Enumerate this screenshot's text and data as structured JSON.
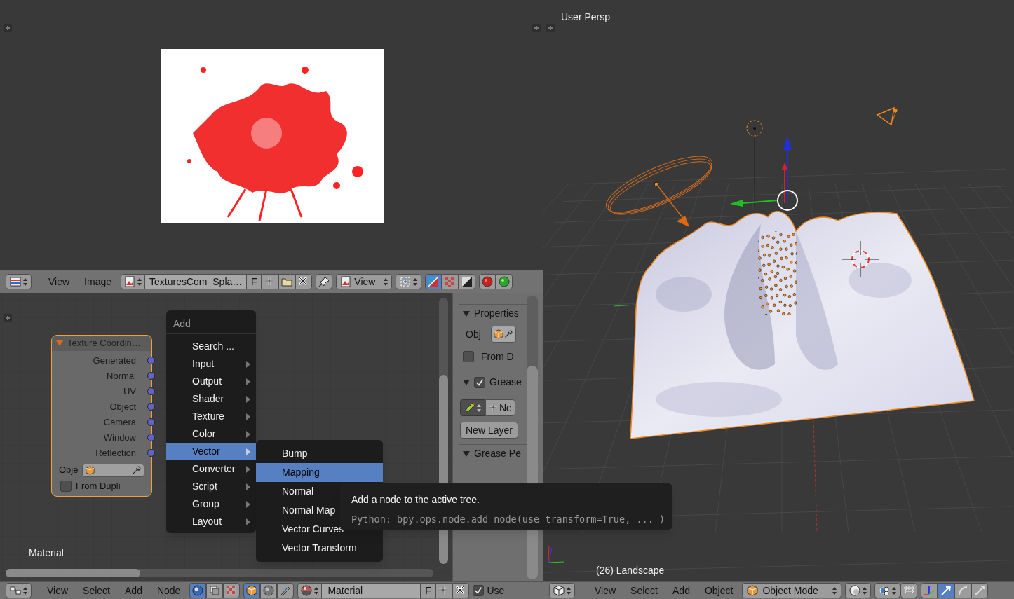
{
  "image_editor": {
    "header": {
      "menus": [
        "View",
        "Image"
      ],
      "image_name": "TexturesCom_Spla…",
      "fake_user": "F",
      "view_mode": "View",
      "display_toggles": [
        {
          "selected": true
        },
        {
          "selected": false
        },
        {
          "selected": false
        }
      ]
    }
  },
  "node_editor": {
    "node": {
      "title": "Texture Coordin…",
      "expanded": true,
      "outputs": [
        "Generated",
        "Normal",
        "UV",
        "Object",
        "Camera",
        "Window",
        "Reflection"
      ],
      "object_label": "Obje",
      "from_dupli": {
        "label": "From Dupli",
        "checked": false
      }
    },
    "tree_name": "Material",
    "side_panel": {
      "panels": [
        {
          "kind": "properties",
          "title": "Properties",
          "expanded": true,
          "object_label": "Obj",
          "from_dupli": {
            "label": "From D",
            "checked": false
          }
        },
        {
          "kind": "grease",
          "title": "Grease",
          "expanded": true,
          "checked": true,
          "new_button": "Ne",
          "new_layer_button": "New Layer"
        },
        {
          "kind": "plain",
          "title": "Grease Pe",
          "expanded": true
        }
      ]
    },
    "add_menu": {
      "title": "Add",
      "items": [
        {
          "label": "Search ...",
          "submenu": false,
          "selected": false
        },
        {
          "label": "Input",
          "submenu": true,
          "selected": false
        },
        {
          "label": "Output",
          "submenu": true,
          "selected": false
        },
        {
          "label": "Shader",
          "submenu": true,
          "selected": false
        },
        {
          "label": "Texture",
          "submenu": true,
          "selected": false
        },
        {
          "label": "Color",
          "submenu": true,
          "selected": false
        },
        {
          "label": "Vector",
          "submenu": true,
          "selected": true
        },
        {
          "label": "Converter",
          "submenu": true,
          "selected": false
        },
        {
          "label": "Script",
          "submenu": true,
          "selected": false
        },
        {
          "label": "Group",
          "submenu": true,
          "selected": false
        },
        {
          "label": "Layout",
          "submenu": true,
          "selected": false
        }
      ]
    },
    "vector_submenu": {
      "items": [
        {
          "label": "Bump",
          "selected": false
        },
        {
          "label": "Mapping",
          "selected": true
        },
        {
          "label": "Normal",
          "selected": false
        },
        {
          "label": "Normal Map",
          "selected": false
        },
        {
          "label": "Vector Curves",
          "selected": false
        },
        {
          "label": "Vector Transform",
          "selected": false
        }
      ]
    },
    "tooltip": {
      "description": "Add a node to the active tree.",
      "python": "Python: bpy.ops.node.add_node(use_transform=True, ... )"
    },
    "header": {
      "menus": [
        "View",
        "Select",
        "Add",
        "Node"
      ],
      "shader_types": [
        {
          "selected": true
        },
        {
          "selected": false
        },
        {
          "selected": false
        }
      ],
      "shader_sources": [
        {
          "selected": true
        },
        {
          "selected": false
        },
        {
          "selected": false
        }
      ],
      "material_name": "Material",
      "fake_user": "F",
      "use_nodes": {
        "label": "Use",
        "checked": true
      }
    }
  },
  "viewport": {
    "view_label": "User Persp",
    "object_label": "(26) Landscape",
    "header": {
      "menus": [
        "View",
        "Select",
        "Add",
        "Object"
      ],
      "mode": "Object Mode",
      "manipulators": [
        {
          "selected": false
        },
        {
          "selected": true
        },
        {
          "selected": false
        },
        {
          "selected": false
        }
      ]
    }
  }
}
